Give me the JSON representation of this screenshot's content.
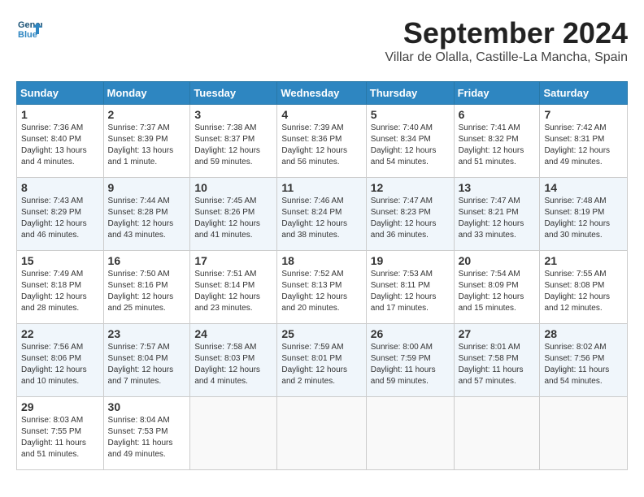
{
  "header": {
    "logo_line1": "General",
    "logo_line2": "Blue",
    "month_title": "September 2024",
    "location": "Villar de Olalla, Castille-La Mancha, Spain"
  },
  "columns": [
    "Sunday",
    "Monday",
    "Tuesday",
    "Wednesday",
    "Thursday",
    "Friday",
    "Saturday"
  ],
  "weeks": [
    [
      {
        "day": "1",
        "sunrise": "Sunrise: 7:36 AM",
        "sunset": "Sunset: 8:40 PM",
        "daylight": "Daylight: 13 hours and 4 minutes."
      },
      {
        "day": "2",
        "sunrise": "Sunrise: 7:37 AM",
        "sunset": "Sunset: 8:39 PM",
        "daylight": "Daylight: 13 hours and 1 minute."
      },
      {
        "day": "3",
        "sunrise": "Sunrise: 7:38 AM",
        "sunset": "Sunset: 8:37 PM",
        "daylight": "Daylight: 12 hours and 59 minutes."
      },
      {
        "day": "4",
        "sunrise": "Sunrise: 7:39 AM",
        "sunset": "Sunset: 8:36 PM",
        "daylight": "Daylight: 12 hours and 56 minutes."
      },
      {
        "day": "5",
        "sunrise": "Sunrise: 7:40 AM",
        "sunset": "Sunset: 8:34 PM",
        "daylight": "Daylight: 12 hours and 54 minutes."
      },
      {
        "day": "6",
        "sunrise": "Sunrise: 7:41 AM",
        "sunset": "Sunset: 8:32 PM",
        "daylight": "Daylight: 12 hours and 51 minutes."
      },
      {
        "day": "7",
        "sunrise": "Sunrise: 7:42 AM",
        "sunset": "Sunset: 8:31 PM",
        "daylight": "Daylight: 12 hours and 49 minutes."
      }
    ],
    [
      {
        "day": "8",
        "sunrise": "Sunrise: 7:43 AM",
        "sunset": "Sunset: 8:29 PM",
        "daylight": "Daylight: 12 hours and 46 minutes."
      },
      {
        "day": "9",
        "sunrise": "Sunrise: 7:44 AM",
        "sunset": "Sunset: 8:28 PM",
        "daylight": "Daylight: 12 hours and 43 minutes."
      },
      {
        "day": "10",
        "sunrise": "Sunrise: 7:45 AM",
        "sunset": "Sunset: 8:26 PM",
        "daylight": "Daylight: 12 hours and 41 minutes."
      },
      {
        "day": "11",
        "sunrise": "Sunrise: 7:46 AM",
        "sunset": "Sunset: 8:24 PM",
        "daylight": "Daylight: 12 hours and 38 minutes."
      },
      {
        "day": "12",
        "sunrise": "Sunrise: 7:47 AM",
        "sunset": "Sunset: 8:23 PM",
        "daylight": "Daylight: 12 hours and 36 minutes."
      },
      {
        "day": "13",
        "sunrise": "Sunrise: 7:47 AM",
        "sunset": "Sunset: 8:21 PM",
        "daylight": "Daylight: 12 hours and 33 minutes."
      },
      {
        "day": "14",
        "sunrise": "Sunrise: 7:48 AM",
        "sunset": "Sunset: 8:19 PM",
        "daylight": "Daylight: 12 hours and 30 minutes."
      }
    ],
    [
      {
        "day": "15",
        "sunrise": "Sunrise: 7:49 AM",
        "sunset": "Sunset: 8:18 PM",
        "daylight": "Daylight: 12 hours and 28 minutes."
      },
      {
        "day": "16",
        "sunrise": "Sunrise: 7:50 AM",
        "sunset": "Sunset: 8:16 PM",
        "daylight": "Daylight: 12 hours and 25 minutes."
      },
      {
        "day": "17",
        "sunrise": "Sunrise: 7:51 AM",
        "sunset": "Sunset: 8:14 PM",
        "daylight": "Daylight: 12 hours and 23 minutes."
      },
      {
        "day": "18",
        "sunrise": "Sunrise: 7:52 AM",
        "sunset": "Sunset: 8:13 PM",
        "daylight": "Daylight: 12 hours and 20 minutes."
      },
      {
        "day": "19",
        "sunrise": "Sunrise: 7:53 AM",
        "sunset": "Sunset: 8:11 PM",
        "daylight": "Daylight: 12 hours and 17 minutes."
      },
      {
        "day": "20",
        "sunrise": "Sunrise: 7:54 AM",
        "sunset": "Sunset: 8:09 PM",
        "daylight": "Daylight: 12 hours and 15 minutes."
      },
      {
        "day": "21",
        "sunrise": "Sunrise: 7:55 AM",
        "sunset": "Sunset: 8:08 PM",
        "daylight": "Daylight: 12 hours and 12 minutes."
      }
    ],
    [
      {
        "day": "22",
        "sunrise": "Sunrise: 7:56 AM",
        "sunset": "Sunset: 8:06 PM",
        "daylight": "Daylight: 12 hours and 10 minutes."
      },
      {
        "day": "23",
        "sunrise": "Sunrise: 7:57 AM",
        "sunset": "Sunset: 8:04 PM",
        "daylight": "Daylight: 12 hours and 7 minutes."
      },
      {
        "day": "24",
        "sunrise": "Sunrise: 7:58 AM",
        "sunset": "Sunset: 8:03 PM",
        "daylight": "Daylight: 12 hours and 4 minutes."
      },
      {
        "day": "25",
        "sunrise": "Sunrise: 7:59 AM",
        "sunset": "Sunset: 8:01 PM",
        "daylight": "Daylight: 12 hours and 2 minutes."
      },
      {
        "day": "26",
        "sunrise": "Sunrise: 8:00 AM",
        "sunset": "Sunset: 7:59 PM",
        "daylight": "Daylight: 11 hours and 59 minutes."
      },
      {
        "day": "27",
        "sunrise": "Sunrise: 8:01 AM",
        "sunset": "Sunset: 7:58 PM",
        "daylight": "Daylight: 11 hours and 57 minutes."
      },
      {
        "day": "28",
        "sunrise": "Sunrise: 8:02 AM",
        "sunset": "Sunset: 7:56 PM",
        "daylight": "Daylight: 11 hours and 54 minutes."
      }
    ],
    [
      {
        "day": "29",
        "sunrise": "Sunrise: 8:03 AM",
        "sunset": "Sunset: 7:55 PM",
        "daylight": "Daylight: 11 hours and 51 minutes."
      },
      {
        "day": "30",
        "sunrise": "Sunrise: 8:04 AM",
        "sunset": "Sunset: 7:53 PM",
        "daylight": "Daylight: 11 hours and 49 minutes."
      },
      null,
      null,
      null,
      null,
      null
    ]
  ]
}
